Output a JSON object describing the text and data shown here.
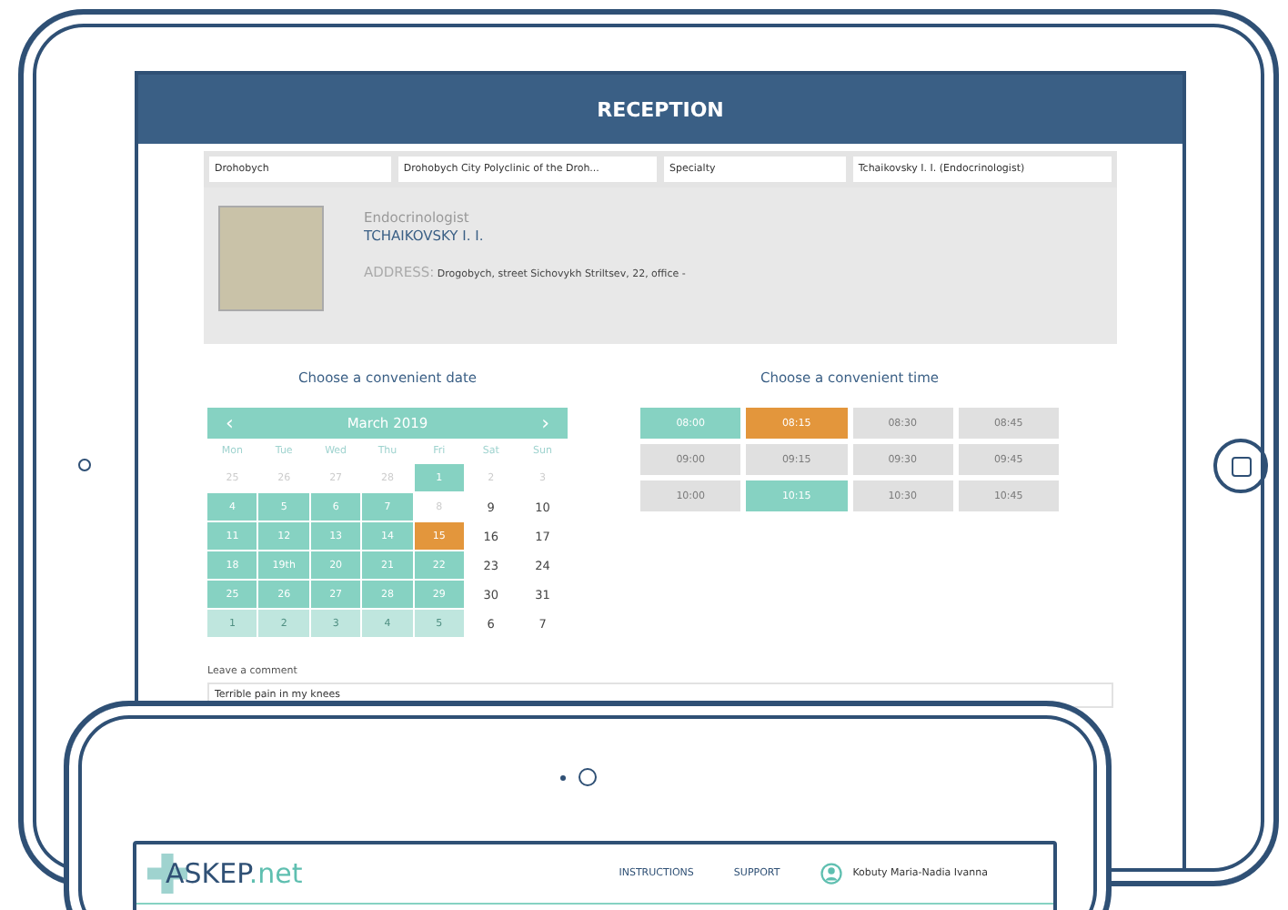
{
  "header": {
    "title": "RECEPTION"
  },
  "filters": [
    {
      "value": "Drohobych"
    },
    {
      "value": "Drohobych City Polyclinic of the Droh..."
    },
    {
      "value": "Specialty"
    },
    {
      "value": "Tchaikovsky I. I. (Endocrinologist)"
    }
  ],
  "doctor": {
    "specialty": "Endocrinologist",
    "name": "TCHAIKOVSKY I. I.",
    "address_label": "ADDRESS:",
    "address": "Drogobych, street Sichovykh Striltsev, 22, office -"
  },
  "date_picker": {
    "heading": "Choose a convenient date",
    "month": "March 2019",
    "prev": "‹",
    "next": "›",
    "weekdays": [
      "Mon",
      "Tue",
      "Wed",
      "Thu",
      "Fri",
      "Sat",
      "Sun"
    ],
    "days": [
      {
        "label": "25",
        "kind": "other",
        "selected": false
      },
      {
        "label": "26",
        "kind": "other",
        "selected": false
      },
      {
        "label": "27",
        "kind": "other",
        "selected": false
      },
      {
        "label": "28",
        "kind": "other",
        "selected": false
      },
      {
        "label": "1",
        "kind": "open",
        "selected": false
      },
      {
        "label": "2",
        "kind": "other",
        "selected": false
      },
      {
        "label": "3",
        "kind": "other",
        "selected": false
      },
      {
        "label": "4",
        "kind": "open",
        "selected": false
      },
      {
        "label": "5",
        "kind": "open",
        "selected": false
      },
      {
        "label": "6",
        "kind": "open",
        "selected": false
      },
      {
        "label": "7",
        "kind": "open",
        "selected": false
      },
      {
        "label": "8",
        "kind": "other",
        "selected": false
      },
      {
        "label": "9",
        "kind": "closed",
        "selected": false
      },
      {
        "label": "10",
        "kind": "closed",
        "selected": false
      },
      {
        "label": "11",
        "kind": "open",
        "selected": false
      },
      {
        "label": "12",
        "kind": "open",
        "selected": false
      },
      {
        "label": "13",
        "kind": "open",
        "selected": false
      },
      {
        "label": "14",
        "kind": "open",
        "selected": false
      },
      {
        "label": "15",
        "kind": "open",
        "selected": true
      },
      {
        "label": "16",
        "kind": "closed",
        "selected": false
      },
      {
        "label": "17",
        "kind": "closed",
        "selected": false
      },
      {
        "label": "18",
        "kind": "open",
        "selected": false
      },
      {
        "label": "19th",
        "kind": "open",
        "selected": false
      },
      {
        "label": "20",
        "kind": "open",
        "selected": false
      },
      {
        "label": "21",
        "kind": "open",
        "selected": false
      },
      {
        "label": "22",
        "kind": "open",
        "selected": false
      },
      {
        "label": "23",
        "kind": "closed",
        "selected": false
      },
      {
        "label": "24",
        "kind": "closed",
        "selected": false
      },
      {
        "label": "25",
        "kind": "open",
        "selected": false
      },
      {
        "label": "26",
        "kind": "open",
        "selected": false
      },
      {
        "label": "27",
        "kind": "open",
        "selected": false
      },
      {
        "label": "28",
        "kind": "open",
        "selected": false
      },
      {
        "label": "29",
        "kind": "open",
        "selected": false
      },
      {
        "label": "30",
        "kind": "closed",
        "selected": false
      },
      {
        "label": "31",
        "kind": "closed",
        "selected": false
      },
      {
        "label": "1",
        "kind": "next",
        "selected": false
      },
      {
        "label": "2",
        "kind": "next",
        "selected": false
      },
      {
        "label": "3",
        "kind": "next",
        "selected": false
      },
      {
        "label": "4",
        "kind": "next",
        "selected": false
      },
      {
        "label": "5",
        "kind": "next",
        "selected": false
      },
      {
        "label": "6",
        "kind": "closed",
        "selected": false
      },
      {
        "label": "7",
        "kind": "closed",
        "selected": false
      }
    ]
  },
  "time_picker": {
    "heading": "Choose a convenient time",
    "slots": [
      {
        "label": "08:00",
        "kind": "free",
        "selected": false
      },
      {
        "label": "08:15",
        "kind": "free",
        "selected": true
      },
      {
        "label": "08:30",
        "kind": "busy",
        "selected": false
      },
      {
        "label": "08:45",
        "kind": "busy",
        "selected": false
      },
      {
        "label": "09:00",
        "kind": "busy",
        "selected": false
      },
      {
        "label": "09:15",
        "kind": "busy",
        "selected": false
      },
      {
        "label": "09:30",
        "kind": "busy",
        "selected": false
      },
      {
        "label": "09:45",
        "kind": "busy",
        "selected": false
      },
      {
        "label": "10:00",
        "kind": "busy",
        "selected": false
      },
      {
        "label": "10:15",
        "kind": "free",
        "selected": false
      },
      {
        "label": "10:30",
        "kind": "busy",
        "selected": false
      },
      {
        "label": "10:45",
        "kind": "busy",
        "selected": false
      }
    ]
  },
  "comment": {
    "label": "Leave a comment",
    "value": "Terrible pain in my knees"
  },
  "second_screen": {
    "logo_main": "ASKEP",
    "logo_suffix": ".net",
    "nav": [
      "INSTRUCTIONS",
      "SUPPORT"
    ],
    "user": "Kobuty Maria-Nadia Ivanna"
  }
}
